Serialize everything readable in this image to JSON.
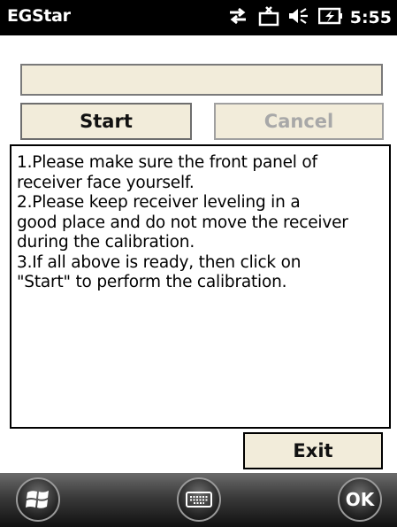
{
  "statusbar": {
    "app_title": "EGStar",
    "time": "5:55",
    "icons": [
      "connectivity-icon",
      "message-icon",
      "volume-icon",
      "battery-charging-icon"
    ]
  },
  "main": {
    "start_label": "Start",
    "cancel_label": "Cancel",
    "instructions": [
      "1.Please make sure the front panel of",
      "receiver face yourself.",
      "2.Please keep receiver leveling in a",
      "good place and do not move the receiver",
      "during the calibration.",
      "3.If all above is ready, then click on",
      "\"Start\" to perform the calibration."
    ],
    "exit_label": "Exit"
  },
  "softkeys": {
    "ok_label": "OK",
    "icons": [
      "windows-start-icon",
      "keyboard-icon"
    ]
  },
  "colors": {
    "statusbar_bg": "#000000",
    "button_bg": "#f2ecda",
    "disabled_text": "#a8a8a8"
  }
}
